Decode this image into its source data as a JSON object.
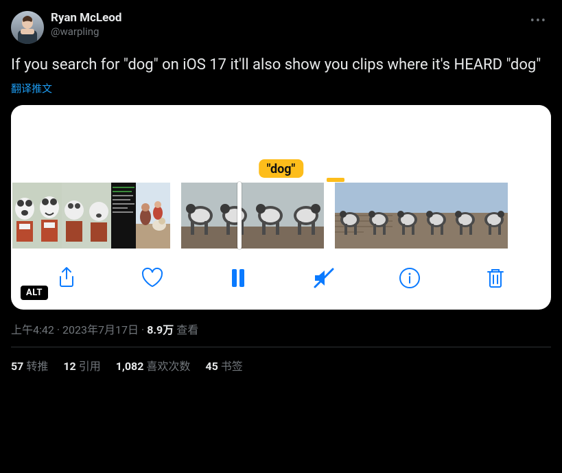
{
  "author": {
    "display_name": "Ryan McLeod",
    "handle": "@warpling"
  },
  "tweet_text": "If you search for \"dog\" on iOS 17 it'll also show you clips where it's HEARD \"dog\"",
  "translate_label": "翻译推文",
  "media": {
    "search_term": "\"dog\"",
    "alt_badge": "ALT"
  },
  "meta": {
    "time": "上午4:42",
    "date": "2023年7月17日",
    "views_count": "8.9万",
    "views_label": "查看"
  },
  "stats": {
    "retweets_count": "57",
    "retweets_label": "转推",
    "quotes_count": "12",
    "quotes_label": "引用",
    "likes_count": "1,082",
    "likes_label": "喜欢次数",
    "bookmarks_count": "45",
    "bookmarks_label": "书签"
  }
}
